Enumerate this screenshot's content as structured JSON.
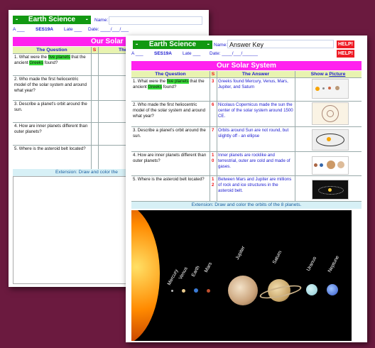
{
  "back_sheet": {
    "banner_left": "-",
    "banner_title": "Earth Science",
    "banner_right": "-",
    "name_label": "Name:",
    "a_label": "A ___",
    "code": "SES19A",
    "late_label": "Late ___",
    "date_label": "Date: ____/___/___",
    "title": "Our Solar",
    "col_question": "The Question",
    "col_s": "S",
    "col_the": "The",
    "questions": [
      {
        "pre": "1. What were the ",
        "hl1": "five planets",
        "mid": " that the ancient ",
        "hl2": "Greeks",
        "post": " found?"
      },
      {
        "text": "2. Who made the first heliocentric model of the solar system and around what year?"
      },
      {
        "text": "3. Describe a planet's orbit around the sun."
      },
      {
        "text": "4. How are inner planets different than outer planets?"
      },
      {
        "text": "5. Where is the asteroid belt located?"
      }
    ],
    "extension": "Extension: Draw and color the"
  },
  "front_sheet": {
    "banner_left": "-",
    "banner_title": "Earth Science",
    "banner_right": "-",
    "name_label": "Name:",
    "name_value": "Answer Key",
    "a_label": "A ___",
    "code": "SES19A",
    "late_label": "Late ___",
    "date_label": "Date: ____/___/______",
    "help": "HELP!",
    "title": "Our Solar System",
    "col_question": "The Question",
    "col_s": "S",
    "col_answer": "The Answer",
    "col_picture_pre": "Show a ",
    "col_picture_link": "Picture",
    "rows": [
      {
        "q_pre": "1. What were the ",
        "hl1": "five planets",
        "q_mid": " that the ancient ",
        "hl2": "Greeks",
        "q_post": " found?",
        "score": "3",
        "answer": "Greeks found Mercury, Venus, Mars, Jupiter, and Saturn"
      },
      {
        "q": "2. Who made the first heliocentric model of the solar system and around what year?",
        "score": "6",
        "answer": "Nicolaus Copernicus made the sun the center of the solar system around 1500 CE."
      },
      {
        "q": "3. Describe a planet's orbit around the sun.",
        "score": "7",
        "answer": "Orbits around Sun are not round, but slightly off - an ellipse"
      },
      {
        "q": "4. How are inner planets different than outer planets?",
        "score": "1\n0",
        "answer": "Inner planets are rocklike and terrestrial, outer are cold and made of gases."
      },
      {
        "q": "5. Where is the asteroid belt located?",
        "score": "1\n2",
        "answer": "Between Mars and Jupiter are millions of rock and ice structures in the asteroid belt."
      }
    ],
    "extension": "Extension: Draw and color the orbits of the 8 planets.",
    "planets": [
      "Mercury",
      "Venus",
      "Earth",
      "Mars",
      "Jupiter",
      "Saturn",
      "Uranus",
      "Neptune"
    ]
  }
}
